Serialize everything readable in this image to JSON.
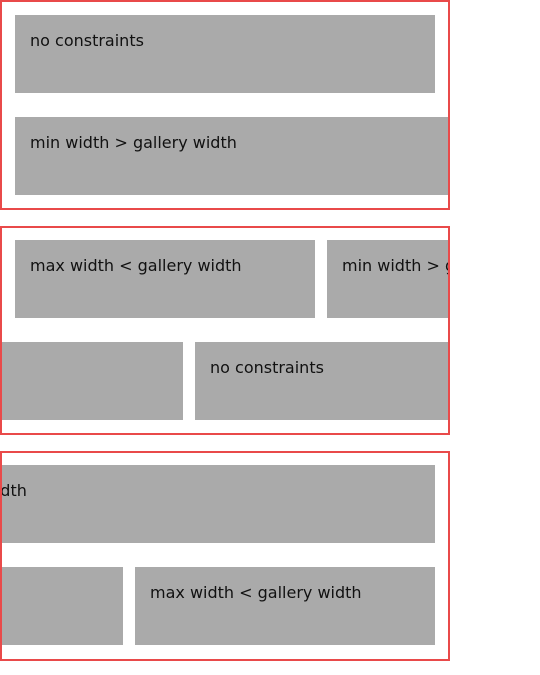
{
  "galleries": [
    {
      "items": [
        {
          "label": "no constraints"
        },
        {
          "label": "min width > gallery width"
        }
      ]
    },
    {
      "items": [
        {
          "label": "max width < gallery width"
        },
        {
          "label": "min width > gallery width"
        },
        {
          "label": ""
        },
        {
          "label": "no constraints"
        }
      ]
    },
    {
      "items": [
        {
          "label": "min width > gallery width"
        },
        {
          "label": ""
        },
        {
          "label": "max width < gallery width"
        }
      ]
    }
  ],
  "colors": {
    "border": "#e94a4a",
    "item": "#aaaaaa",
    "text": "#111111"
  }
}
